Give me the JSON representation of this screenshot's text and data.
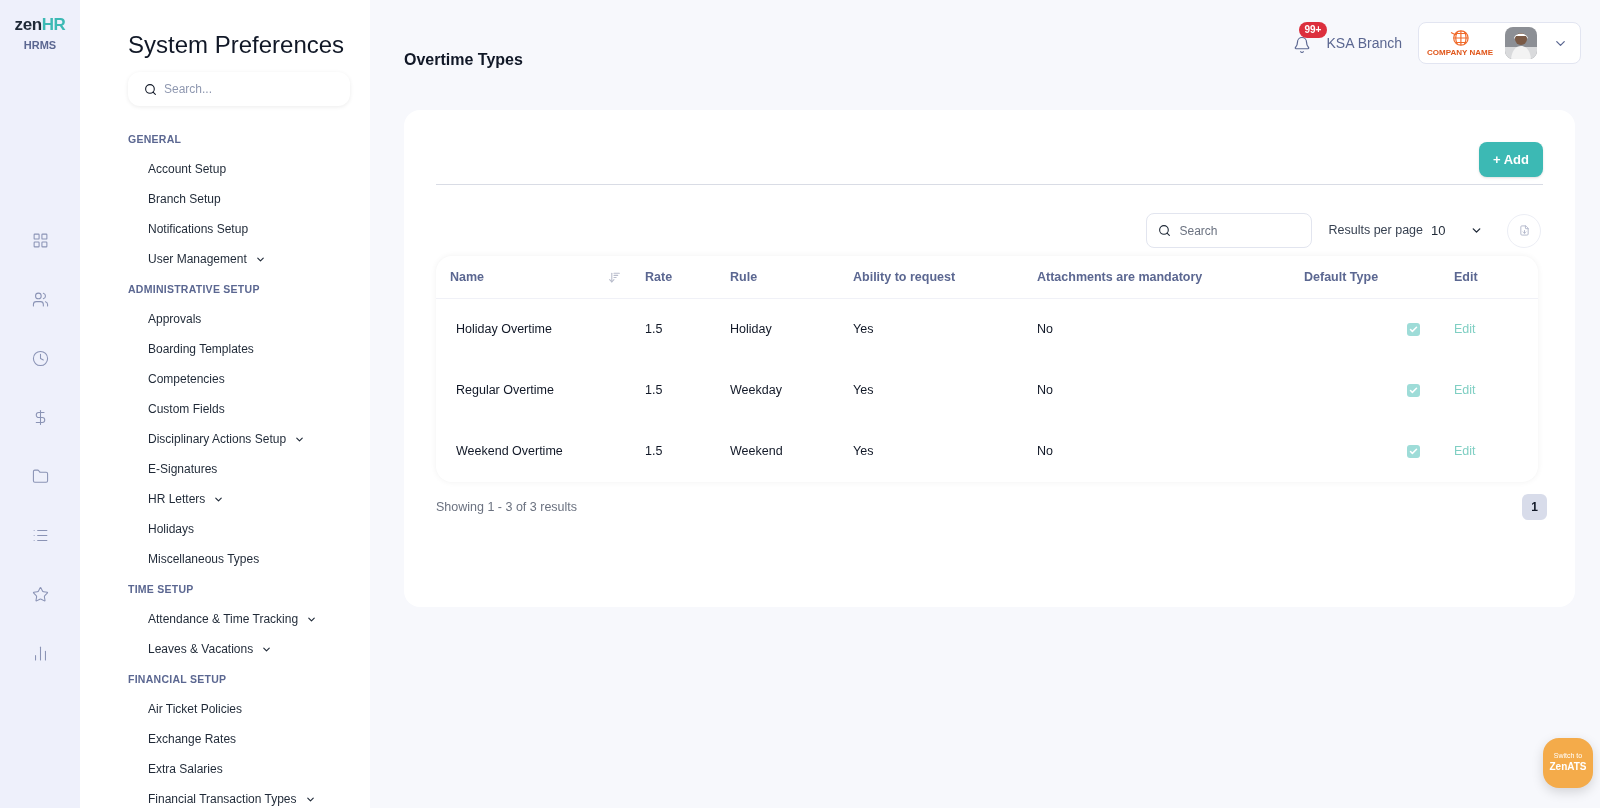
{
  "logo": {
    "word": "zen",
    "accent": "HR",
    "subtitle": "HRMS"
  },
  "rail": [
    {
      "kind": "grid"
    },
    {
      "kind": "users"
    },
    {
      "kind": "clock"
    },
    {
      "kind": "dollar"
    },
    {
      "kind": "folder"
    },
    {
      "kind": "list"
    },
    {
      "kind": "star"
    },
    {
      "kind": "chart"
    }
  ],
  "sidebar": {
    "title": "System Preferences",
    "search": {
      "placeholder": "Search..."
    },
    "sections": [
      {
        "heading": "GENERAL",
        "items": [
          {
            "label": "Account Setup",
            "expandable": false
          },
          {
            "label": "Branch Setup",
            "expandable": false
          },
          {
            "label": "Notifications Setup",
            "expandable": false
          },
          {
            "label": "User Management",
            "expandable": true
          }
        ]
      },
      {
        "heading": "ADMINISTRATIVE SETUP",
        "items": [
          {
            "label": "Approvals",
            "expandable": false
          },
          {
            "label": "Boarding Templates",
            "expandable": false
          },
          {
            "label": "Competencies",
            "expandable": false
          },
          {
            "label": "Custom Fields",
            "expandable": false
          },
          {
            "label": "Disciplinary Actions Setup",
            "expandable": true
          },
          {
            "label": "E-Signatures",
            "expandable": false
          },
          {
            "label": "HR Letters",
            "expandable": true
          },
          {
            "label": "Holidays",
            "expandable": false
          },
          {
            "label": "Miscellaneous Types",
            "expandable": false
          }
        ]
      },
      {
        "heading": "TIME SETUP",
        "items": [
          {
            "label": "Attendance & Time Tracking",
            "expandable": true
          },
          {
            "label": "Leaves & Vacations",
            "expandable": true
          }
        ]
      },
      {
        "heading": "FINANCIAL SETUP",
        "items": [
          {
            "label": "Air Ticket Policies",
            "expandable": false
          },
          {
            "label": "Exchange Rates",
            "expandable": false
          },
          {
            "label": "Extra Salaries",
            "expandable": false
          },
          {
            "label": "Financial Transaction Types",
            "expandable": true
          }
        ]
      }
    ]
  },
  "header": {
    "page_title": "Overtime Types",
    "notifications_badge": "99+",
    "branch": "KSA Branch",
    "company_logo_text": "COMPANY NAME"
  },
  "toolbar": {
    "add_button": "+ Add",
    "search": {
      "placeholder": "Search"
    },
    "results_label": "Results per page",
    "results_value": "10"
  },
  "table": {
    "columns": [
      {
        "label": "Name",
        "sortable": true
      },
      {
        "label": "Rate",
        "sortable": false
      },
      {
        "label": "Rule",
        "sortable": false
      },
      {
        "label": "Ability to request",
        "sortable": false
      },
      {
        "label": "Attachments are mandatory",
        "sortable": false
      },
      {
        "label": "Default Type",
        "sortable": false
      },
      {
        "label": "Edit",
        "sortable": false
      }
    ],
    "rows": [
      {
        "name": "Holiday Overtime",
        "rate": "1.5",
        "rule": "Holiday",
        "ability": "Yes",
        "attachments": "No",
        "default": true,
        "edit": "Edit"
      },
      {
        "name": "Regular Overtime",
        "rate": "1.5",
        "rule": "Weekday",
        "ability": "Yes",
        "attachments": "No",
        "default": true,
        "edit": "Edit"
      },
      {
        "name": "Weekend Overtime",
        "rate": "1.5",
        "rule": "Weekend",
        "ability": "Yes",
        "attachments": "No",
        "default": true,
        "edit": "Edit"
      }
    ]
  },
  "footer": {
    "summary": "Showing 1 - 3 of 3 results",
    "pages": [
      {
        "label": "1",
        "selected": true
      }
    ]
  },
  "switch_button": {
    "line1": "Switch to",
    "line2": "ZenATS"
  }
}
